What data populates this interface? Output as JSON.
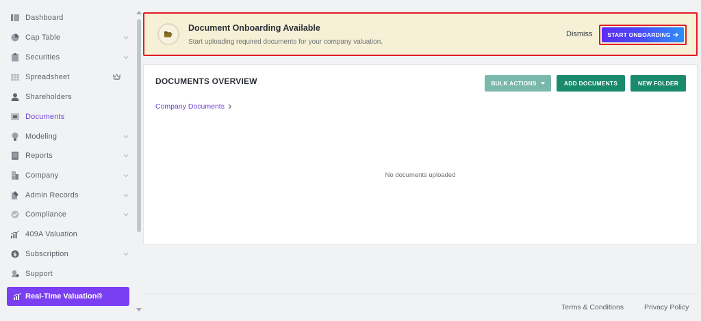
{
  "sidebar": {
    "items": [
      {
        "label": "Dashboard",
        "icon": "dashboard-icon",
        "chevron": false
      },
      {
        "label": "Cap Table",
        "icon": "pie-chart-icon",
        "chevron": true
      },
      {
        "label": "Securities",
        "icon": "clipboard-icon",
        "chevron": true
      },
      {
        "label": "Spreadsheet",
        "icon": "spreadsheet-icon",
        "chevron": false,
        "badge_icon": "crown-icon"
      },
      {
        "label": "Shareholders",
        "icon": "user-icon",
        "chevron": false
      },
      {
        "label": "Documents",
        "icon": "folder-icon",
        "chevron": false,
        "active": true
      },
      {
        "label": "Modeling",
        "icon": "bulb-icon",
        "chevron": true
      },
      {
        "label": "Reports",
        "icon": "report-icon",
        "chevron": true
      },
      {
        "label": "Company",
        "icon": "building-icon",
        "chevron": true
      },
      {
        "label": "Admin Records",
        "icon": "records-icon",
        "chevron": true
      },
      {
        "label": "Compliance",
        "icon": "shield-check-icon",
        "chevron": true
      },
      {
        "label": "409A Valuation",
        "icon": "bar-chart-icon",
        "chevron": false
      },
      {
        "label": "Subscription",
        "icon": "dollar-circle-icon",
        "chevron": true
      },
      {
        "label": "Support",
        "icon": "support-icon",
        "chevron": false
      }
    ],
    "cta": {
      "label": "Real-Time Valuation®",
      "icon": "bar-chart-icon"
    }
  },
  "banner": {
    "title": "Document Onboarding Available",
    "subtitle": "Start uploading required documents for your company valuation.",
    "dismiss_label": "Dismiss",
    "start_label": "START ONBOARDING"
  },
  "documents": {
    "heading": "DOCUMENTS OVERVIEW",
    "bulk_label": "BULK ACTIONS",
    "add_label": "ADD DOCUMENTS",
    "folder_label": "NEW FOLDER",
    "breadcrumb": "Company Documents",
    "empty_text": "No documents uploaded"
  },
  "footer": {
    "terms": "Terms & Conditions",
    "privacy": "Privacy Policy"
  },
  "colors": {
    "accent": "#7b3ff2",
    "active_text": "#6c3fd6",
    "banner_bg": "#f6f0d6",
    "highlight_border": "#e01b24",
    "green": "#1a8a6c"
  }
}
